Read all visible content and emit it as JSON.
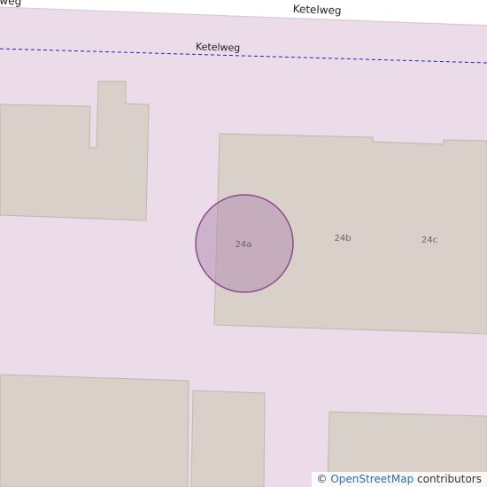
{
  "map": {
    "roads": [
      {
        "name": "Ketelweg"
      },
      {
        "name": "lweg"
      }
    ],
    "boundary_label": "Ketelweg",
    "house_numbers": [
      "24a",
      "24b",
      "24c"
    ],
    "highlight": {
      "label": "24a",
      "fill": "#b48fb4",
      "stroke": "#8b4b8b"
    },
    "colors": {
      "landuse": "#ecdbe9",
      "road": "#ffffff",
      "building": "#d9d0c9",
      "building_outline": "#c4b6ab",
      "boundary": "#1a22c9"
    }
  },
  "attribution": {
    "symbol": "©",
    "link_text": "OpenStreetMap",
    "suffix": " contributors"
  }
}
